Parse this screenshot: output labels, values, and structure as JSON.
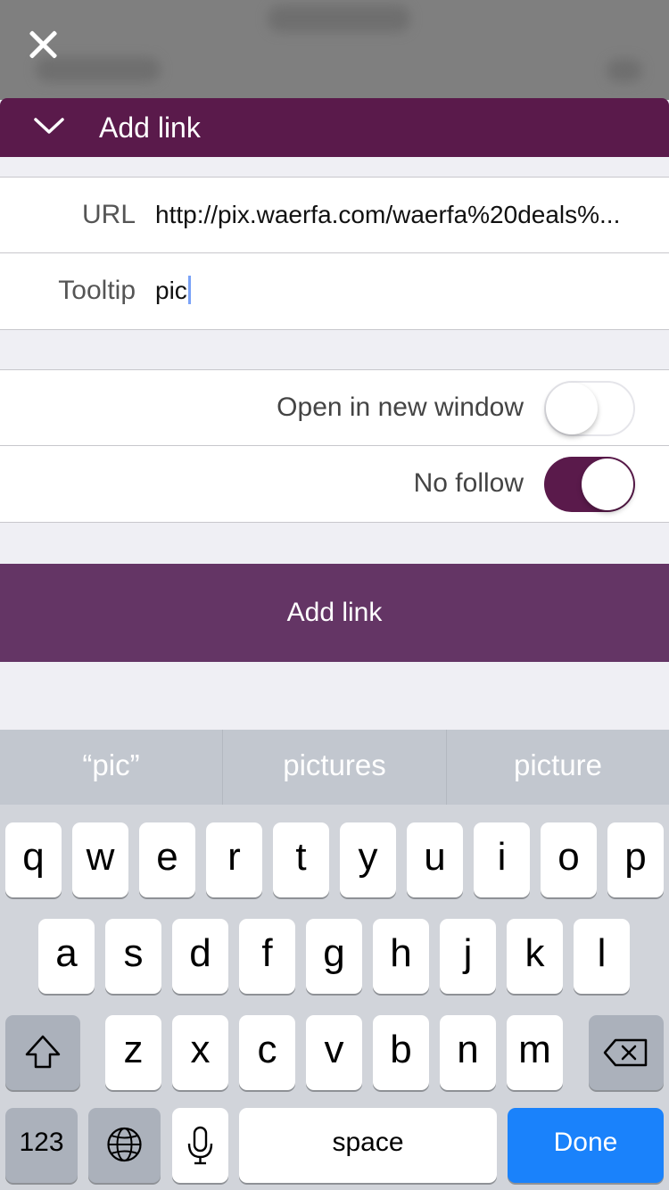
{
  "header": {
    "title": "Add link"
  },
  "form": {
    "url_label": "URL",
    "url_value": "http://pix.waerfa.com/waerfa%20deals%...",
    "tooltip_label": "Tooltip",
    "tooltip_value": "pic"
  },
  "options": {
    "new_window_label": "Open in new window",
    "new_window_on": false,
    "no_follow_label": "No follow",
    "no_follow_on": true
  },
  "submit_label": "Add link",
  "colors": {
    "brand": "#5a1a4b",
    "button": "#643565",
    "keyboard_done": "#1a82fb"
  },
  "keyboard": {
    "suggestions": [
      "“pic”",
      "pictures",
      "picture"
    ],
    "row1": [
      "q",
      "w",
      "e",
      "r",
      "t",
      "y",
      "u",
      "i",
      "o",
      "p"
    ],
    "row2": [
      "a",
      "s",
      "d",
      "f",
      "g",
      "h",
      "j",
      "k",
      "l"
    ],
    "row3": [
      "z",
      "x",
      "c",
      "v",
      "b",
      "n",
      "m"
    ],
    "numbers_label": "123",
    "space_label": "space",
    "done_label": "Done"
  }
}
